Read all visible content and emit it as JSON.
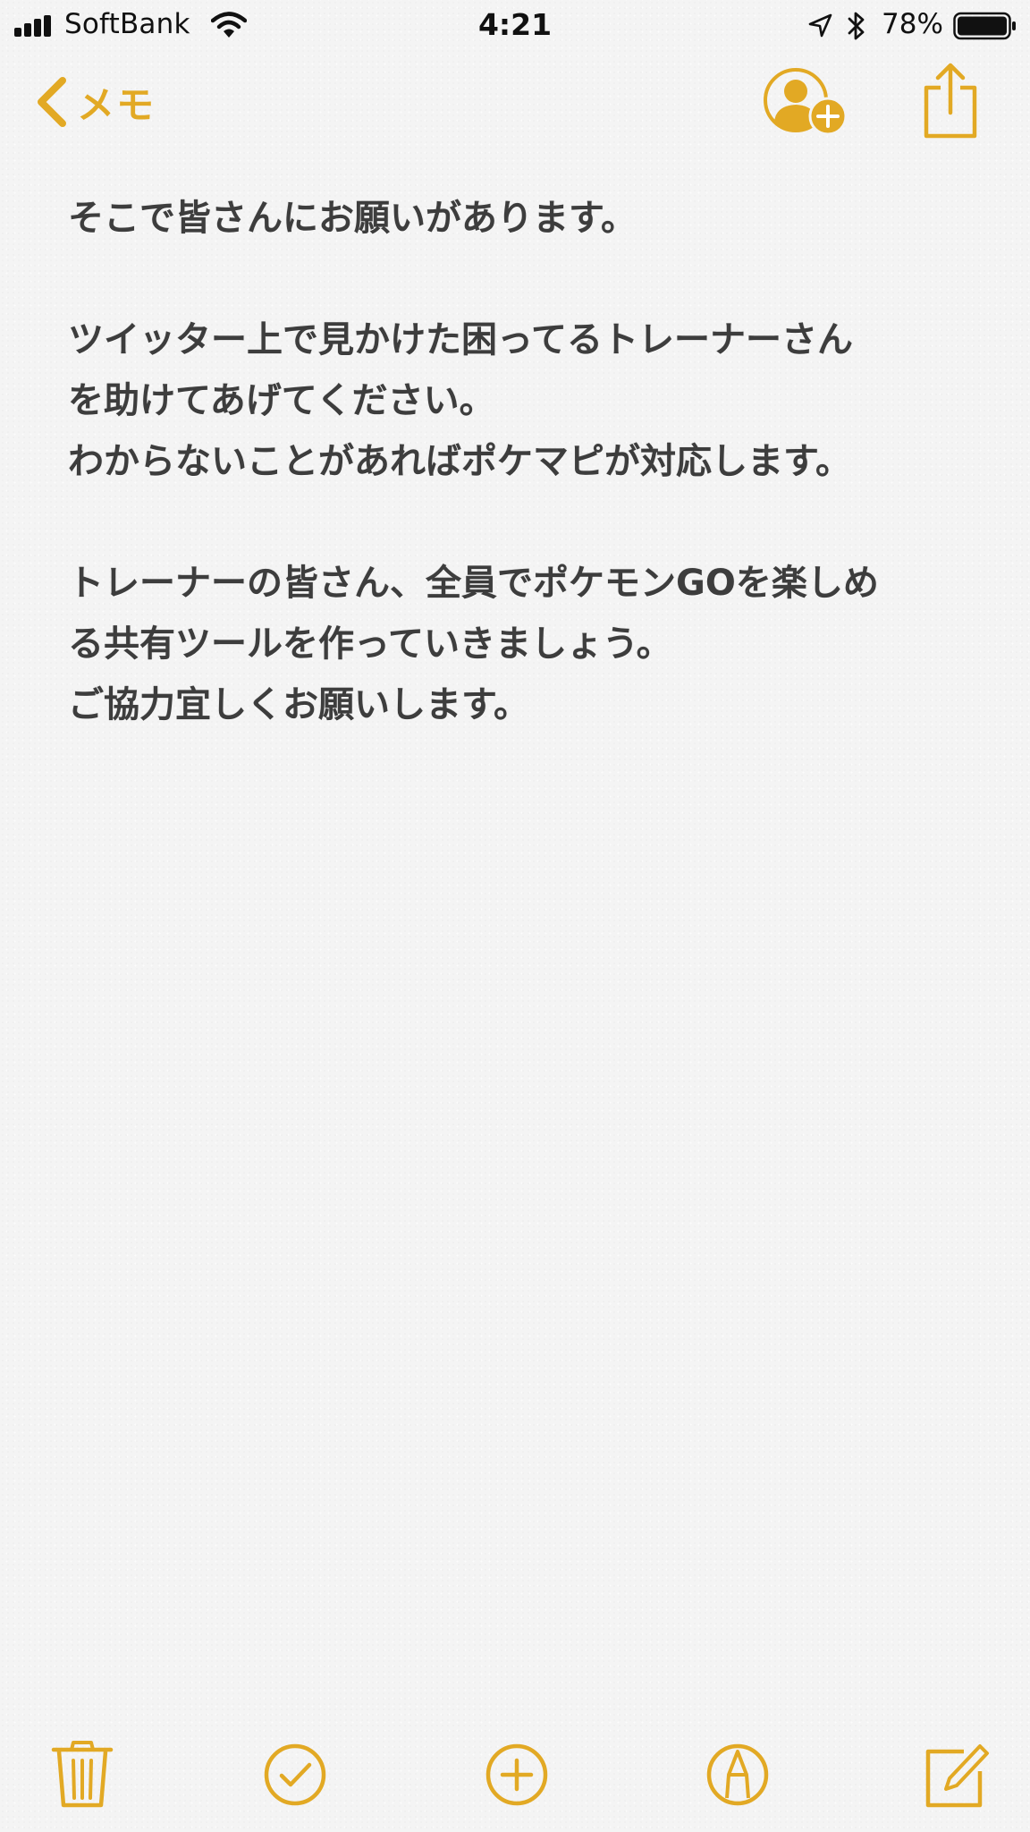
{
  "status_bar": {
    "carrier": "SoftBank",
    "time": "4:21",
    "battery_percent": "78%",
    "battery_level": 0.78,
    "icons": [
      "signal-icon",
      "wifi-icon",
      "location-arrow-icon",
      "bluetooth-icon",
      "battery-icon"
    ]
  },
  "nav": {
    "back_label": "メモ",
    "back_icon": "chevron-left-icon",
    "add_person_icon": "add-person-icon",
    "share_icon": "share-icon"
  },
  "note": {
    "lines": [
      "そこで皆さんにお願いがあります。",
      "",
      "ツイッター上で見かけた困ってるトレーナーさん",
      "を助けてあげてください。",
      "わからないことがあればポケマピが対応します。",
      "",
      "トレーナーの皆さん、全員でポケモンGOを楽しめ",
      "る共有ツールを作っていきましょう。",
      "ご協力宜しくお願いします。"
    ]
  },
  "toolbar": {
    "items": [
      "trash-icon",
      "checklist-icon",
      "add-icon",
      "markup-icon",
      "compose-icon"
    ]
  },
  "colors": {
    "accent": "#e2a924",
    "text": "#3d3d3d",
    "background": "#f4f4f4"
  }
}
